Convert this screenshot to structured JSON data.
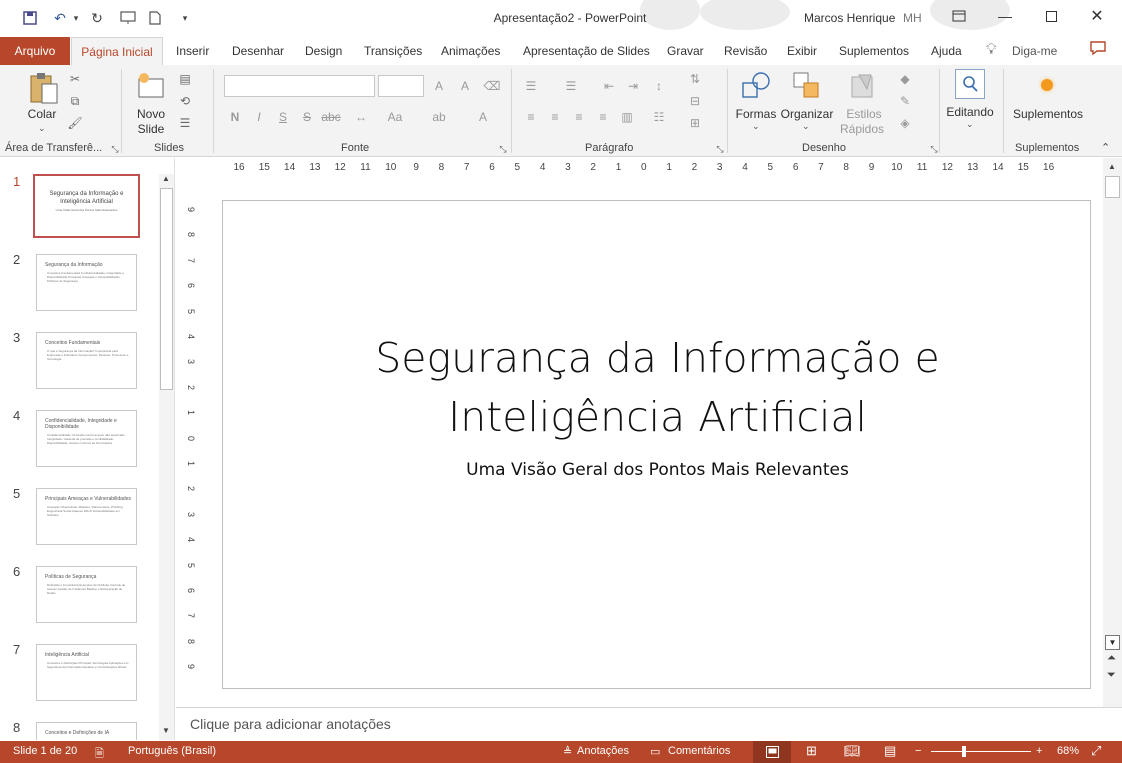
{
  "window": {
    "doc_title": "Apresentação2  -  PowerPoint",
    "user_name": "Marcos Henrique",
    "user_initials": "MH"
  },
  "tabs": {
    "file": "Arquivo",
    "active": "Página Inicial",
    "items": [
      "Inserir",
      "Desenhar",
      "Design",
      "Transições",
      "Animações",
      "Apresentação de Slides",
      "Gravar",
      "Revisão",
      "Exibir",
      "Suplementos",
      "Ajuda"
    ],
    "tell_me": "Diga-me"
  },
  "ribbon": {
    "clipboard": {
      "paste_label": "Colar",
      "group": "Área de Transferê..."
    },
    "slides": {
      "new_slide_line1": "Novo",
      "new_slide_line2": "Slide",
      "group": "Slides"
    },
    "font": {
      "group": "Fonte",
      "bold": "N",
      "italic": "I",
      "underline": "S",
      "strike": "S",
      "spacing": "abc",
      "case": "Aa"
    },
    "paragraph": {
      "group": "Parágrafo"
    },
    "drawing": {
      "group": "Desenho",
      "shapes": "Formas",
      "arrange": "Organizar",
      "quick_styles_line1": "Estilos",
      "quick_styles_line2": "Rápidos"
    },
    "editing": {
      "label": "Editando"
    },
    "addins": {
      "label": "Suplementos",
      "group": "Suplementos"
    }
  },
  "thumbnails": [
    {
      "num": "1",
      "title": "Segurança da Informação e Inteligência Artificial",
      "body": "Uma Visão Geral dos Pontos Mais Relevantes"
    },
    {
      "num": "2",
      "title": "Segurança da Informação",
      "body": "Conceitos Fundamentais Confidencialidade, Integridade e Disponibilidade Principais Ameaças e Vulnerabilidades Políticas de Segurança"
    },
    {
      "num": "3",
      "title": "Conceitos Fundamentais",
      "body": "O que é Segurança da Informação? Importância para Empresas e Indivíduos Componentes: Pessoas, Processos e Tecnologia"
    },
    {
      "num": "4",
      "title": "Confidencialidade, Integridade e Disponibilidade",
      "body": "Confidencialidade: Proteção contra acesso não autorizado Integridade: Garantia de precisão e confiabilidade Disponibilidade: Acesso contínuo às informações"
    },
    {
      "num": "5",
      "title": "Principais Ameaças e Vulnerabilidades",
      "body": "Ameaças Cibernéticas: Malware, Ransomware, Phishing Engenharia Social Ataques DDoS Vulnerabilidades em Software"
    },
    {
      "num": "6",
      "title": "Políticas de Segurança",
      "body": "Definição e Importância Exemplos de Políticas Controle de Acesso Gestão de Incidentes Backup e Recuperação de Dados"
    },
    {
      "num": "7",
      "title": "Inteligência Artificial",
      "body": "Conceitos e Definições Principais Tecnologias Aplicações em Segurança da Informação Desafios e Considerações Éticas"
    },
    {
      "num": "8",
      "title": "Conceitos e Definições de IA",
      "body": ""
    }
  ],
  "hruler_numbers": [
    "16",
    "15",
    "14",
    "13",
    "12",
    "11",
    "10",
    "9",
    "8",
    "7",
    "6",
    "5",
    "4",
    "3",
    "2",
    "1",
    "0",
    "1",
    "2",
    "3",
    "4",
    "5",
    "6",
    "7",
    "8",
    "9",
    "10",
    "11",
    "12",
    "13",
    "14",
    "15",
    "16"
  ],
  "vruler_numbers": [
    "9",
    "8",
    "7",
    "6",
    "5",
    "4",
    "3",
    "2",
    "1",
    "0",
    "1",
    "2",
    "3",
    "4",
    "5",
    "6",
    "7",
    "8",
    "9"
  ],
  "slide": {
    "title_line1": "Segurança da Informação e",
    "title_line2": "Inteligência Artificial",
    "subtitle": "Uma Visão Geral dos Pontos Mais Relevantes"
  },
  "notes": {
    "placeholder": "Clique para adicionar anotações"
  },
  "status": {
    "slide_count": "Slide 1 de 20",
    "language": "Português (Brasil)",
    "notes": "Anotações",
    "comments": "Comentários",
    "zoom": "68%"
  },
  "colors": {
    "accent": "#b7472a",
    "ribbon_bg": "#f3f3f3"
  }
}
